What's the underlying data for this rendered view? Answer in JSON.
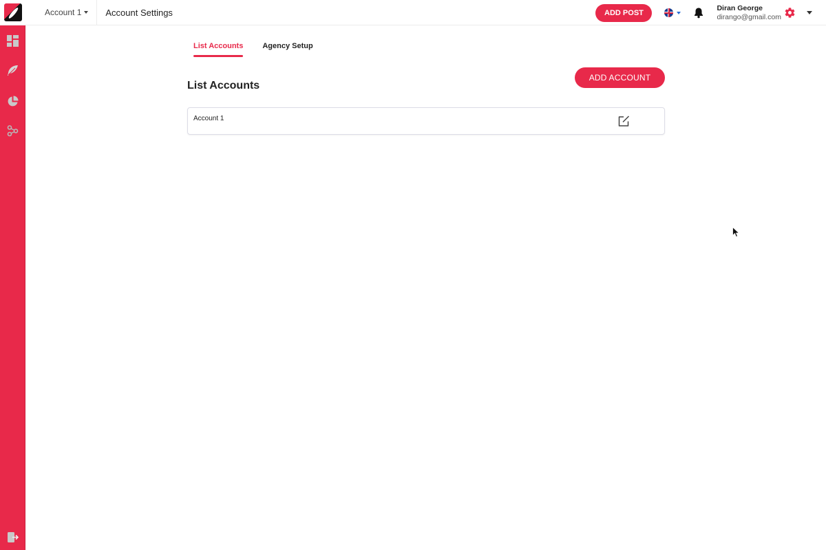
{
  "topbar": {
    "account_switcher": "Account 1",
    "page_title": "Account Settings",
    "add_post_label": "ADD POST",
    "language": "English (UK)",
    "user": {
      "name": "Diran George",
      "email": "dirango@gmail.com"
    }
  },
  "sidebar": {
    "items": [
      {
        "icon": "dashboard-icon"
      },
      {
        "icon": "feather-icon"
      },
      {
        "icon": "pie-chart-icon"
      },
      {
        "icon": "network-icon"
      }
    ],
    "bottom_item": {
      "icon": "logout-icon"
    }
  },
  "tabs": [
    {
      "label": "List Accounts",
      "active": true
    },
    {
      "label": "Agency Setup",
      "active": false
    }
  ],
  "main": {
    "section_title": "List Accounts",
    "add_account_label": "ADD ACCOUNT",
    "accounts": [
      {
        "name": "Account 1"
      }
    ]
  },
  "colors": {
    "accent": "#e8294a"
  }
}
